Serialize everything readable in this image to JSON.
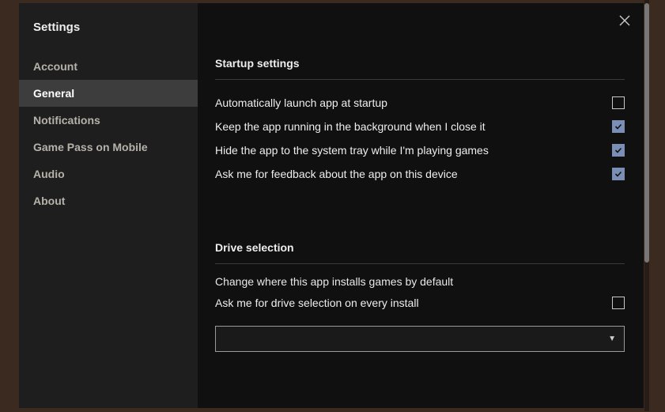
{
  "title": "Settings",
  "sidebar": {
    "items": [
      {
        "label": "Account",
        "active": false
      },
      {
        "label": "General",
        "active": true
      },
      {
        "label": "Notifications",
        "active": false
      },
      {
        "label": "Game Pass on Mobile",
        "active": false
      },
      {
        "label": "Audio",
        "active": false
      },
      {
        "label": "About",
        "active": false
      }
    ]
  },
  "sections": {
    "startup": {
      "title": "Startup settings",
      "options": [
        {
          "label": "Automatically launch app at startup",
          "checked": false
        },
        {
          "label": "Keep the app running in the background when I close it",
          "checked": true
        },
        {
          "label": "Hide the app to the system tray while I'm playing games",
          "checked": true
        },
        {
          "label": "Ask me for feedback about the app on this device",
          "checked": true
        }
      ]
    },
    "drive": {
      "title": "Drive selection",
      "description": "Change where this app installs games by default",
      "ask_label": "Ask me for drive selection on every install",
      "ask_checked": false,
      "selected": ""
    }
  }
}
